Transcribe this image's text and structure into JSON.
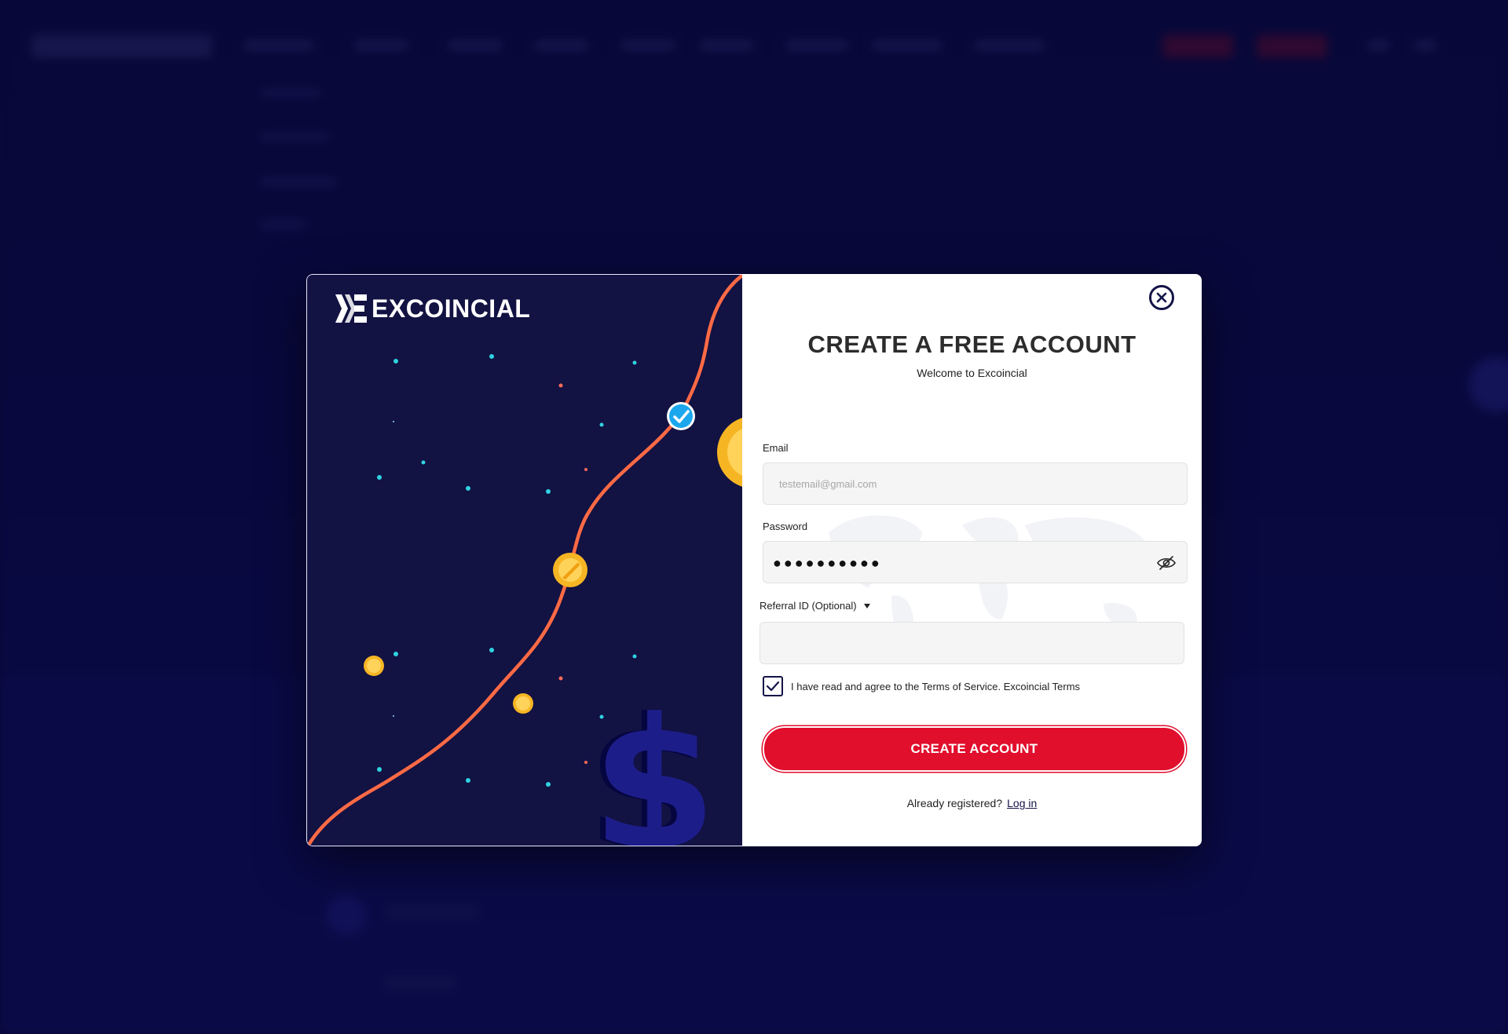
{
  "brand": {
    "name": "EXCOINCIAL"
  },
  "modal": {
    "title": "CREATE A FREE ACCOUNT",
    "subtitle": "Welcome to Excoincial",
    "close_icon": "close-circle-icon"
  },
  "form": {
    "email": {
      "label": "Email",
      "placeholder": "testemail@gmail.com",
      "value": ""
    },
    "password": {
      "label": "Password",
      "masked_value": "●●●●●●●●●●",
      "toggle_icon": "eye-slash-icon"
    },
    "referral": {
      "label": "Referral ID (Optional)",
      "value": "",
      "toggle_icon": "caret-down-icon"
    },
    "terms": {
      "checked": true,
      "text": "I have read and agree to the Terms of Service. Excoincial Terms"
    },
    "submit_label": "CREATE ACCOUNT",
    "login_prompt": "Already registered?",
    "login_link": "Log in"
  },
  "colors": {
    "accent": "#e10e2c",
    "navy": "#131347",
    "panel": "#121243",
    "curve": "#ff6a45",
    "coin": "#f6b523",
    "check_badge": "#1ba7ee"
  }
}
